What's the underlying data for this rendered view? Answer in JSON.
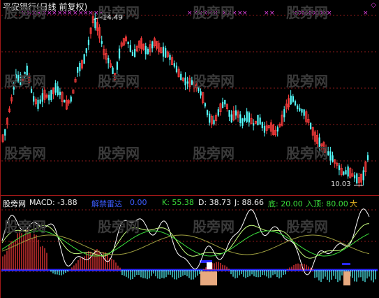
{
  "title": "平安银行(日线 前复权)",
  "watermark": "股旁网",
  "price": {
    "high_label": "14.49",
    "low_label": "10.03"
  },
  "indicator": {
    "brand": "股旁网",
    "macd": "MACD: -3.88",
    "pattern_label": "解禁雷达",
    "pattern_value": "0.00",
    "k": "K: 55.38",
    "d": "D: 38.73",
    "j": "J: 88.66",
    "bottom_label": "底: 20.00",
    "enter_top": "入顶: 80.00",
    "big": "大"
  },
  "colors": {
    "up": "#ff3c3c",
    "down": "#54ffff",
    "macd_blue": "#2828ff",
    "pattern_fill": "#e8aa80",
    "marker": "#e040e0",
    "grid": "#8b1a1a"
  }
}
